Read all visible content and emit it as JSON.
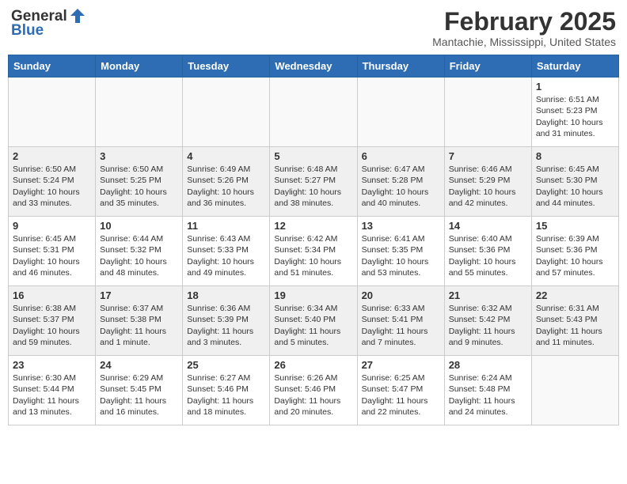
{
  "header": {
    "logo_general": "General",
    "logo_blue": "Blue",
    "month": "February 2025",
    "location": "Mantachie, Mississippi, United States"
  },
  "weekdays": [
    "Sunday",
    "Monday",
    "Tuesday",
    "Wednesday",
    "Thursday",
    "Friday",
    "Saturday"
  ],
  "weeks": [
    [
      {
        "day": "",
        "text": ""
      },
      {
        "day": "",
        "text": ""
      },
      {
        "day": "",
        "text": ""
      },
      {
        "day": "",
        "text": ""
      },
      {
        "day": "",
        "text": ""
      },
      {
        "day": "",
        "text": ""
      },
      {
        "day": "1",
        "text": "Sunrise: 6:51 AM\nSunset: 5:23 PM\nDaylight: 10 hours and 31 minutes."
      }
    ],
    [
      {
        "day": "2",
        "text": "Sunrise: 6:50 AM\nSunset: 5:24 PM\nDaylight: 10 hours and 33 minutes."
      },
      {
        "day": "3",
        "text": "Sunrise: 6:50 AM\nSunset: 5:25 PM\nDaylight: 10 hours and 35 minutes."
      },
      {
        "day": "4",
        "text": "Sunrise: 6:49 AM\nSunset: 5:26 PM\nDaylight: 10 hours and 36 minutes."
      },
      {
        "day": "5",
        "text": "Sunrise: 6:48 AM\nSunset: 5:27 PM\nDaylight: 10 hours and 38 minutes."
      },
      {
        "day": "6",
        "text": "Sunrise: 6:47 AM\nSunset: 5:28 PM\nDaylight: 10 hours and 40 minutes."
      },
      {
        "day": "7",
        "text": "Sunrise: 6:46 AM\nSunset: 5:29 PM\nDaylight: 10 hours and 42 minutes."
      },
      {
        "day": "8",
        "text": "Sunrise: 6:45 AM\nSunset: 5:30 PM\nDaylight: 10 hours and 44 minutes."
      }
    ],
    [
      {
        "day": "9",
        "text": "Sunrise: 6:45 AM\nSunset: 5:31 PM\nDaylight: 10 hours and 46 minutes."
      },
      {
        "day": "10",
        "text": "Sunrise: 6:44 AM\nSunset: 5:32 PM\nDaylight: 10 hours and 48 minutes."
      },
      {
        "day": "11",
        "text": "Sunrise: 6:43 AM\nSunset: 5:33 PM\nDaylight: 10 hours and 49 minutes."
      },
      {
        "day": "12",
        "text": "Sunrise: 6:42 AM\nSunset: 5:34 PM\nDaylight: 10 hours and 51 minutes."
      },
      {
        "day": "13",
        "text": "Sunrise: 6:41 AM\nSunset: 5:35 PM\nDaylight: 10 hours and 53 minutes."
      },
      {
        "day": "14",
        "text": "Sunrise: 6:40 AM\nSunset: 5:36 PM\nDaylight: 10 hours and 55 minutes."
      },
      {
        "day": "15",
        "text": "Sunrise: 6:39 AM\nSunset: 5:36 PM\nDaylight: 10 hours and 57 minutes."
      }
    ],
    [
      {
        "day": "16",
        "text": "Sunrise: 6:38 AM\nSunset: 5:37 PM\nDaylight: 10 hours and 59 minutes."
      },
      {
        "day": "17",
        "text": "Sunrise: 6:37 AM\nSunset: 5:38 PM\nDaylight: 11 hours and 1 minute."
      },
      {
        "day": "18",
        "text": "Sunrise: 6:36 AM\nSunset: 5:39 PM\nDaylight: 11 hours and 3 minutes."
      },
      {
        "day": "19",
        "text": "Sunrise: 6:34 AM\nSunset: 5:40 PM\nDaylight: 11 hours and 5 minutes."
      },
      {
        "day": "20",
        "text": "Sunrise: 6:33 AM\nSunset: 5:41 PM\nDaylight: 11 hours and 7 minutes."
      },
      {
        "day": "21",
        "text": "Sunrise: 6:32 AM\nSunset: 5:42 PM\nDaylight: 11 hours and 9 minutes."
      },
      {
        "day": "22",
        "text": "Sunrise: 6:31 AM\nSunset: 5:43 PM\nDaylight: 11 hours and 11 minutes."
      }
    ],
    [
      {
        "day": "23",
        "text": "Sunrise: 6:30 AM\nSunset: 5:44 PM\nDaylight: 11 hours and 13 minutes."
      },
      {
        "day": "24",
        "text": "Sunrise: 6:29 AM\nSunset: 5:45 PM\nDaylight: 11 hours and 16 minutes."
      },
      {
        "day": "25",
        "text": "Sunrise: 6:27 AM\nSunset: 5:46 PM\nDaylight: 11 hours and 18 minutes."
      },
      {
        "day": "26",
        "text": "Sunrise: 6:26 AM\nSunset: 5:46 PM\nDaylight: 11 hours and 20 minutes."
      },
      {
        "day": "27",
        "text": "Sunrise: 6:25 AM\nSunset: 5:47 PM\nDaylight: 11 hours and 22 minutes."
      },
      {
        "day": "28",
        "text": "Sunrise: 6:24 AM\nSunset: 5:48 PM\nDaylight: 11 hours and 24 minutes."
      },
      {
        "day": "",
        "text": ""
      }
    ]
  ]
}
